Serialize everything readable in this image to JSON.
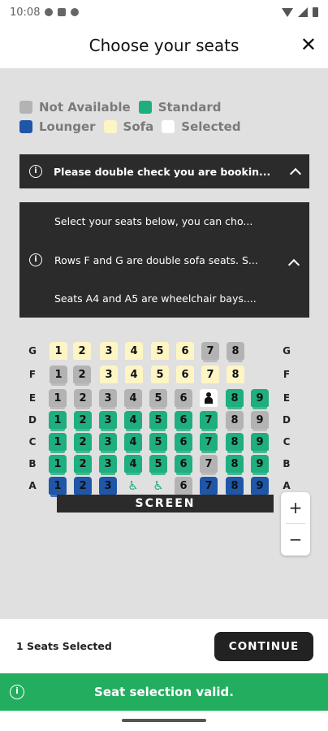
{
  "status_bar": {
    "time": "10:08"
  },
  "header": {
    "title": "Choose your seats",
    "close_label": "✕"
  },
  "legend": [
    {
      "label": "Not Available",
      "color": "#b3b3b3"
    },
    {
      "label": "Standard",
      "color": "#1fae7f"
    },
    {
      "label": "Lounger",
      "color": "#1f56a8"
    },
    {
      "label": "Sofa",
      "color": "#fdf5c4"
    },
    {
      "label": "Selected",
      "color": "#ffffff"
    }
  ],
  "notices": {
    "collapsed": "Please double check you are bookin...",
    "expanded": [
      "Select your seats below, you can cho...",
      "Rows F and G are double sofa seats. S...",
      "Seats A4 and A5 are wheelchair bays...."
    ]
  },
  "seat_map": {
    "rows": [
      {
        "label": "G",
        "seats": [
          {
            "n": "1",
            "type": "sofa"
          },
          {
            "n": "2",
            "type": "sofa"
          },
          {
            "n": "3",
            "type": "sofa"
          },
          {
            "n": "4",
            "type": "sofa"
          },
          {
            "n": "5",
            "type": "sofa"
          },
          {
            "n": "6",
            "type": "sofa"
          },
          {
            "n": "7",
            "type": "sofa-na"
          },
          {
            "n": "8",
            "type": "sofa-na"
          }
        ]
      },
      {
        "label": "F",
        "seats": [
          {
            "n": "1",
            "type": "sofa-na"
          },
          {
            "n": "2",
            "type": "sofa-na"
          },
          {
            "n": "3",
            "type": "sofa"
          },
          {
            "n": "4",
            "type": "sofa"
          },
          {
            "n": "5",
            "type": "sofa"
          },
          {
            "n": "6",
            "type": "sofa"
          },
          {
            "n": "7",
            "type": "sofa"
          },
          {
            "n": "8",
            "type": "sofa"
          }
        ]
      },
      {
        "label": "E",
        "seats": [
          {
            "n": "1",
            "type": "na"
          },
          {
            "n": "2",
            "type": "na"
          },
          {
            "n": "3",
            "type": "na"
          },
          {
            "n": "4",
            "type": "na"
          },
          {
            "n": "5",
            "type": "na"
          },
          {
            "n": "6",
            "type": "na"
          },
          {
            "n": "",
            "type": "selected"
          },
          {
            "n": "8",
            "type": "std"
          },
          {
            "n": "9",
            "type": "std"
          }
        ]
      },
      {
        "label": "D",
        "seats": [
          {
            "n": "1",
            "type": "std"
          },
          {
            "n": "2",
            "type": "std"
          },
          {
            "n": "3",
            "type": "std"
          },
          {
            "n": "4",
            "type": "std"
          },
          {
            "n": "5",
            "type": "std"
          },
          {
            "n": "6",
            "type": "std"
          },
          {
            "n": "7",
            "type": "std"
          },
          {
            "n": "8",
            "type": "na"
          },
          {
            "n": "9",
            "type": "na"
          }
        ]
      },
      {
        "label": "C",
        "seats": [
          {
            "n": "1",
            "type": "std"
          },
          {
            "n": "2",
            "type": "std"
          },
          {
            "n": "3",
            "type": "std"
          },
          {
            "n": "4",
            "type": "std"
          },
          {
            "n": "5",
            "type": "std"
          },
          {
            "n": "6",
            "type": "std"
          },
          {
            "n": "7",
            "type": "std"
          },
          {
            "n": "8",
            "type": "std"
          },
          {
            "n": "9",
            "type": "std"
          }
        ]
      },
      {
        "label": "B",
        "seats": [
          {
            "n": "1",
            "type": "std"
          },
          {
            "n": "2",
            "type": "std"
          },
          {
            "n": "3",
            "type": "std"
          },
          {
            "n": "4",
            "type": "std"
          },
          {
            "n": "5",
            "type": "std"
          },
          {
            "n": "6",
            "type": "std"
          },
          {
            "n": "7",
            "type": "na"
          },
          {
            "n": "8",
            "type": "std"
          },
          {
            "n": "9",
            "type": "std"
          }
        ]
      },
      {
        "label": "A",
        "seats": [
          {
            "n": "1",
            "type": "lounger"
          },
          {
            "n": "2",
            "type": "lounger"
          },
          {
            "n": "3",
            "type": "lounger"
          },
          {
            "n": "4",
            "type": "wc"
          },
          {
            "n": "5",
            "type": "wc"
          },
          {
            "n": "6",
            "type": "na"
          },
          {
            "n": "7",
            "type": "lounger"
          },
          {
            "n": "8",
            "type": "lounger"
          },
          {
            "n": "9",
            "type": "lounger"
          }
        ]
      }
    ],
    "screen_label": "SCREEN",
    "zoom_in": "+",
    "zoom_out": "−"
  },
  "footer": {
    "seats_selected": "1 Seats Selected",
    "continue_label": "CONTINUE"
  },
  "toast": {
    "message": "Seat selection valid.",
    "icon_label": "i"
  }
}
